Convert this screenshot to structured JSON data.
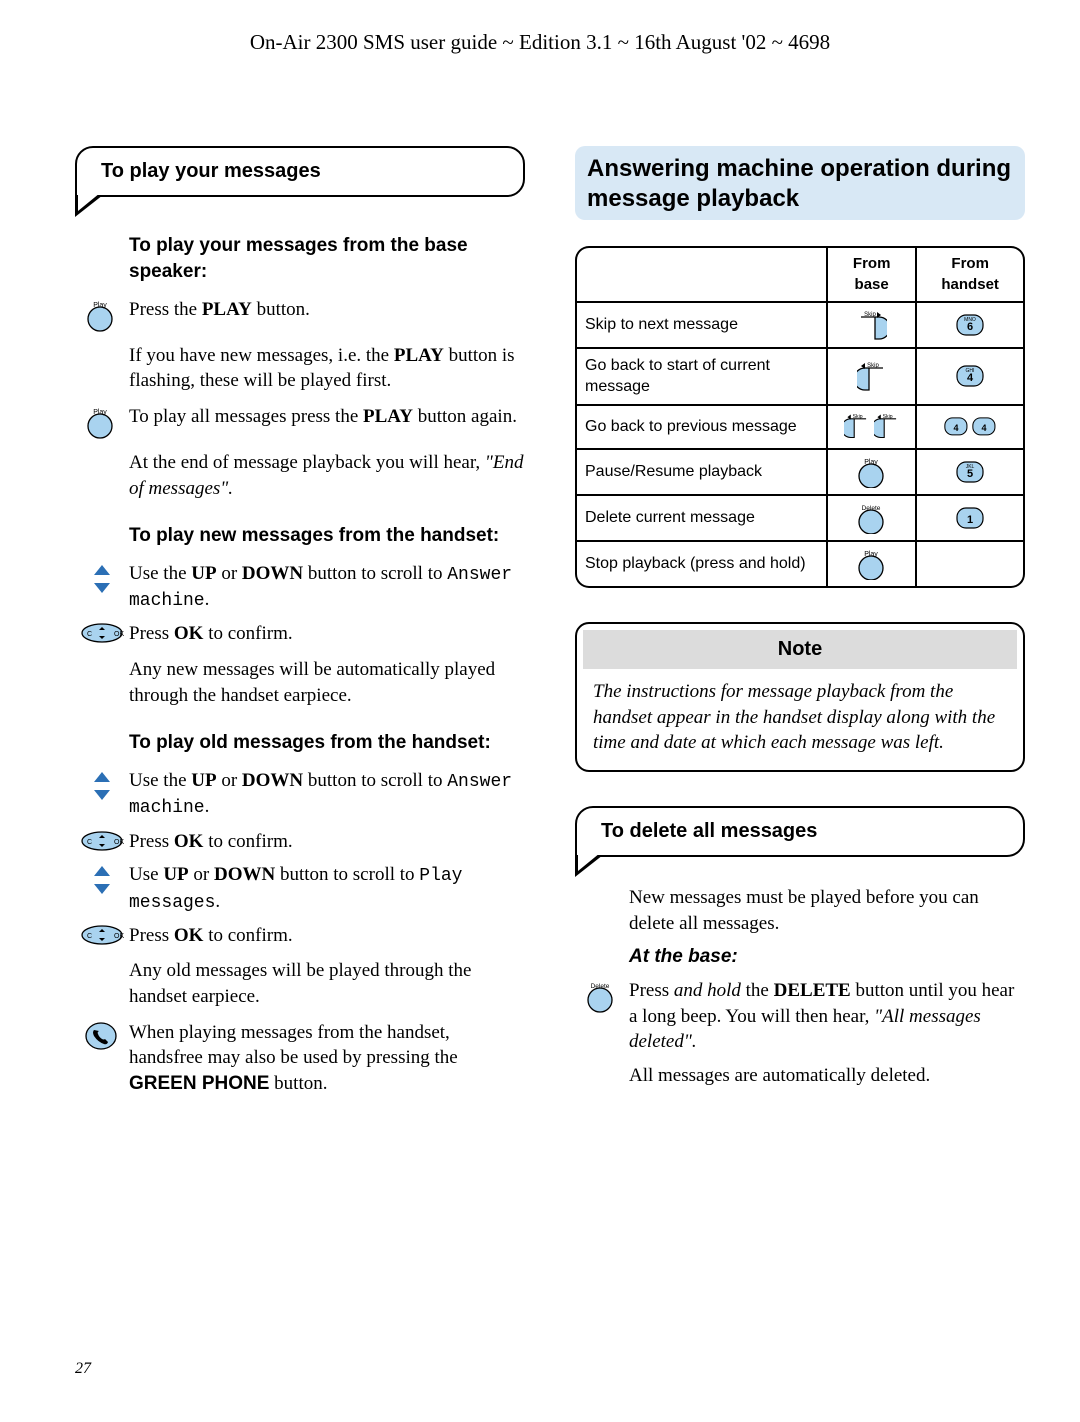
{
  "header": "On-Air 2300 SMS user guide ~ Edition 3.1 ~ 16th August '02 ~ 4698",
  "page_number": "27",
  "left": {
    "tab": "To play your messages",
    "sec1_title": "To play your messages from the base speaker:",
    "sec1_l1a": "Press the ",
    "sec1_l1b": "PLAY",
    "sec1_l1c": " button.",
    "sec1_l2a": "If you have new messages, i.e. the ",
    "sec1_l2b": "PLAY",
    "sec1_l2c": " button is flashing, these will be played first.",
    "sec1_l3a": "To play all messages press the ",
    "sec1_l3b": "PLAY",
    "sec1_l3c": " button again.",
    "sec1_l4a": "At the end of message playback you will hear, ",
    "sec1_l4b": "\"End of messages\".",
    "sec2_title": "To play new messages from the handset:",
    "sec2_l1a": "Use the ",
    "sec2_l1b": "UP",
    "sec2_l1c": " or ",
    "sec2_l1d": "DOWN",
    "sec2_l1e": " button to scroll to ",
    "sec2_l1f": "Answer machine",
    "sec2_l1g": ".",
    "sec2_l2a": "Press ",
    "sec2_l2b": "OK",
    "sec2_l2c": " to confirm.",
    "sec2_l3": "Any new messages will be automatically played through the handset earpiece.",
    "sec3_title": "To play old messages from the handset:",
    "sec3_l1a": "Use the ",
    "sec3_l1b": "UP",
    "sec3_l1c": " or ",
    "sec3_l1d": "DOWN",
    "sec3_l1e": " button to scroll to ",
    "sec3_l1f": "Answer machine",
    "sec3_l1g": ".",
    "sec3_l2a": "Press ",
    "sec3_l2b": "OK",
    "sec3_l2c": " to confirm.",
    "sec3_l3a": "Use ",
    "sec3_l3b": "UP",
    "sec3_l3c": " or ",
    "sec3_l3d": "DOWN",
    "sec3_l3e": " button to scroll to ",
    "sec3_l3f": "Play messages",
    "sec3_l3g": ".",
    "sec3_l4a": "Press ",
    "sec3_l4b": "OK",
    "sec3_l4c": " to confirm.",
    "sec3_l5": "Any old messages will be played through the handset earpiece.",
    "sec3_l6a": "When playing messages from the handset, handsfree may also be used by pressing the ",
    "sec3_l6b": "GREEN PHONE",
    "sec3_l6c": " button."
  },
  "right": {
    "title": "Answering machine operation during message playback",
    "th1": "From base",
    "th2": "From handset",
    "rows": [
      {
        "label": "Skip to next message",
        "base": "skip-fwd",
        "hand": "key-6"
      },
      {
        "label": "Go back to start of current message",
        "base": "skip-back",
        "hand": "key-4"
      },
      {
        "label": "Go back to previous message",
        "base": "skip-back-2",
        "hand": "key-4-2"
      },
      {
        "label": "Pause/Resume playback",
        "base": "play",
        "hand": "key-5"
      },
      {
        "label": "Delete current message",
        "base": "delete",
        "hand": "key-1"
      },
      {
        "label": "Stop playback (press and hold)",
        "base": "play",
        "hand": ""
      }
    ],
    "note_title": "Note",
    "note_body": "The instructions for message playback from the handset appear in the handset display along with the time and date at which each message was left.",
    "tab2": "To delete all messages",
    "del_l1": "New messages must be played before you can delete all messages.",
    "del_sub": "At the base:",
    "del_l2a": "Press ",
    "del_l2b": "and hold",
    "del_l2c": " the ",
    "del_l2d": "DELETE",
    "del_l2e": " button until you hear a long beep. You will then hear, ",
    "del_l2f": "\"All messages deleted\".",
    "del_l3": "All messages are automatically deleted."
  },
  "icons": {
    "play": "Play",
    "delete": "Delete",
    "skip": "Skip",
    "k1": "1",
    "k4": "4",
    "k4s": "GHI",
    "k5": "5",
    "k5s": "JKL",
    "k6": "6",
    "k6s": "MNO"
  }
}
